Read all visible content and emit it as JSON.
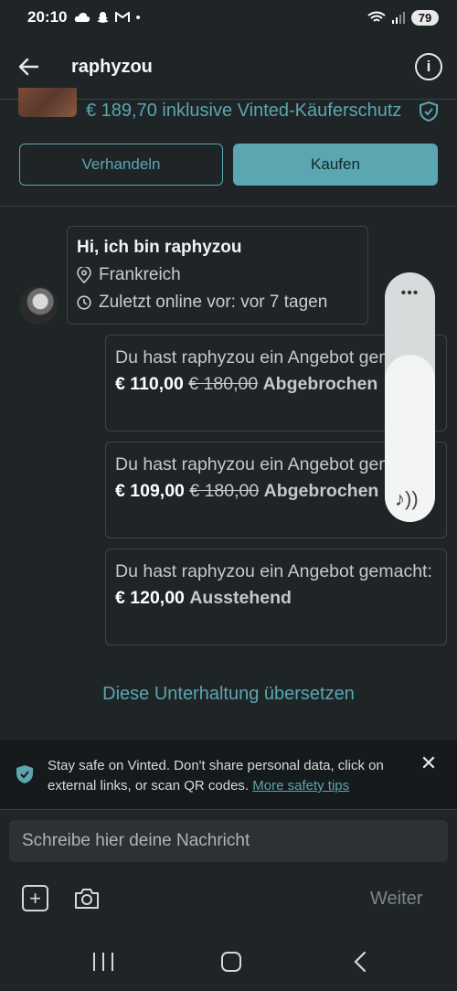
{
  "status_bar": {
    "time": "20:10",
    "icons": [
      "cloud-icon",
      "snapchat-icon",
      "gmail-icon",
      "dot-icon"
    ],
    "battery": "79"
  },
  "header": {
    "title": "raphyzou"
  },
  "listing": {
    "price_text": "€ 189,70 inklusive Vinted-Käuferschutz",
    "negotiate_label": "Verhandeln",
    "buy_label": "Kaufen"
  },
  "profile": {
    "greeting": "Hi, ich bin raphyzou",
    "location": "Frankreich",
    "last_online": "Zuletzt online vor: vor 7 tagen"
  },
  "offers": [
    {
      "text": "Du hast raphyzou ein Angebot gemacht:",
      "amount": "€ 110,00",
      "original": "€ 180,00",
      "status": "Abgebrochen"
    },
    {
      "text": "Du hast raphyzou ein Angebot gemacht:",
      "amount": "€ 109,00",
      "original": "€ 180,00",
      "status": "Abgebrochen"
    },
    {
      "text": "Du hast raphyzou ein Angebot gemacht:",
      "amount": "€ 120,00",
      "original": "",
      "status": "Ausstehend"
    }
  ],
  "volume": {
    "level": 0.67
  },
  "translate_label": "Diese Unterhaltung übersetzen",
  "safety": {
    "text": "Stay safe on Vinted. Don't share personal data, click on external links, or scan QR codes.",
    "link": "More safety tips"
  },
  "composer": {
    "placeholder": "Schreibe hier deine Nachricht",
    "send_label": "Weiter"
  },
  "colors": {
    "accent": "#5ba6b0",
    "background": "#1f2427"
  }
}
